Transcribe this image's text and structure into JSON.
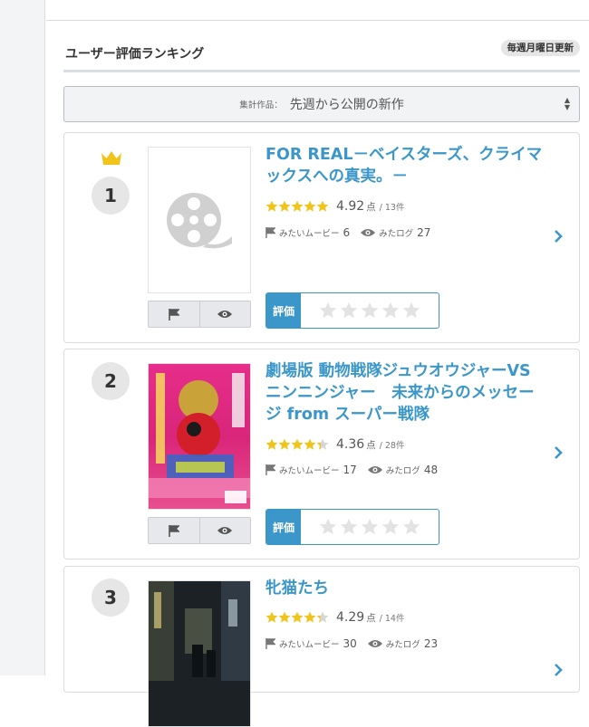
{
  "header": {
    "title": "ユーザー評価ランキング",
    "badge": "毎週月曜日更新"
  },
  "filter": {
    "label": "集計作品：",
    "value": "先週から公開の新作"
  },
  "colors": {
    "accent": "#3b97c9",
    "star": "#f0c419"
  },
  "rate_label": "評価",
  "items": [
    {
      "rank": "1",
      "title": "FOR REAL－ベイスターズ、クライマックスへの真実。－",
      "score": "4.92",
      "score_value": 4.92,
      "unit": "点",
      "count": "/ 13件",
      "want_label": "みたいムービー",
      "want": "6",
      "seen_label": "みたログ",
      "seen": "27",
      "crown": true
    },
    {
      "rank": "2",
      "title": "劇場版 動物戦隊ジュウオウジャーVSニンニンジャー　未来からのメッセージ from スーパー戦隊",
      "score": "4.36",
      "score_value": 4.36,
      "unit": "点",
      "count": "/ 28件",
      "want_label": "みたいムービー",
      "want": "17",
      "seen_label": "みたログ",
      "seen": "48"
    },
    {
      "rank": "3",
      "title": "牝猫たち",
      "score": "4.29",
      "score_value": 4.29,
      "unit": "点",
      "count": "/ 14件",
      "want_label": "みたいムービー",
      "want": "30",
      "seen_label": "みたログ",
      "seen": "23"
    }
  ]
}
